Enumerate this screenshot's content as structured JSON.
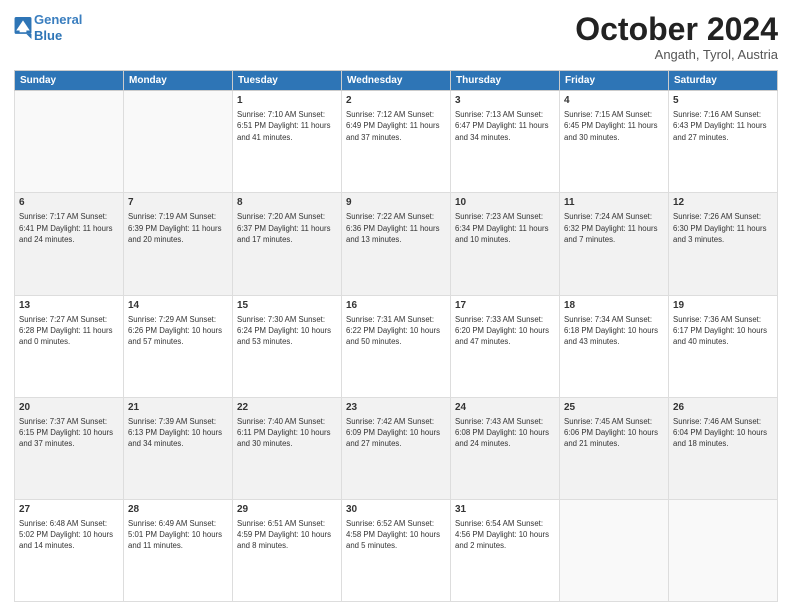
{
  "header": {
    "logo_line1": "General",
    "logo_line2": "Blue",
    "month": "October 2024",
    "location": "Angath, Tyrol, Austria"
  },
  "weekdays": [
    "Sunday",
    "Monday",
    "Tuesday",
    "Wednesday",
    "Thursday",
    "Friday",
    "Saturday"
  ],
  "weeks": [
    [
      {
        "day": "",
        "info": ""
      },
      {
        "day": "",
        "info": ""
      },
      {
        "day": "1",
        "info": "Sunrise: 7:10 AM\nSunset: 6:51 PM\nDaylight: 11 hours and 41 minutes."
      },
      {
        "day": "2",
        "info": "Sunrise: 7:12 AM\nSunset: 6:49 PM\nDaylight: 11 hours and 37 minutes."
      },
      {
        "day": "3",
        "info": "Sunrise: 7:13 AM\nSunset: 6:47 PM\nDaylight: 11 hours and 34 minutes."
      },
      {
        "day": "4",
        "info": "Sunrise: 7:15 AM\nSunset: 6:45 PM\nDaylight: 11 hours and 30 minutes."
      },
      {
        "day": "5",
        "info": "Sunrise: 7:16 AM\nSunset: 6:43 PM\nDaylight: 11 hours and 27 minutes."
      }
    ],
    [
      {
        "day": "6",
        "info": "Sunrise: 7:17 AM\nSunset: 6:41 PM\nDaylight: 11 hours and 24 minutes."
      },
      {
        "day": "7",
        "info": "Sunrise: 7:19 AM\nSunset: 6:39 PM\nDaylight: 11 hours and 20 minutes."
      },
      {
        "day": "8",
        "info": "Sunrise: 7:20 AM\nSunset: 6:37 PM\nDaylight: 11 hours and 17 minutes."
      },
      {
        "day": "9",
        "info": "Sunrise: 7:22 AM\nSunset: 6:36 PM\nDaylight: 11 hours and 13 minutes."
      },
      {
        "day": "10",
        "info": "Sunrise: 7:23 AM\nSunset: 6:34 PM\nDaylight: 11 hours and 10 minutes."
      },
      {
        "day": "11",
        "info": "Sunrise: 7:24 AM\nSunset: 6:32 PM\nDaylight: 11 hours and 7 minutes."
      },
      {
        "day": "12",
        "info": "Sunrise: 7:26 AM\nSunset: 6:30 PM\nDaylight: 11 hours and 3 minutes."
      }
    ],
    [
      {
        "day": "13",
        "info": "Sunrise: 7:27 AM\nSunset: 6:28 PM\nDaylight: 11 hours and 0 minutes."
      },
      {
        "day": "14",
        "info": "Sunrise: 7:29 AM\nSunset: 6:26 PM\nDaylight: 10 hours and 57 minutes."
      },
      {
        "day": "15",
        "info": "Sunrise: 7:30 AM\nSunset: 6:24 PM\nDaylight: 10 hours and 53 minutes."
      },
      {
        "day": "16",
        "info": "Sunrise: 7:31 AM\nSunset: 6:22 PM\nDaylight: 10 hours and 50 minutes."
      },
      {
        "day": "17",
        "info": "Sunrise: 7:33 AM\nSunset: 6:20 PM\nDaylight: 10 hours and 47 minutes."
      },
      {
        "day": "18",
        "info": "Sunrise: 7:34 AM\nSunset: 6:18 PM\nDaylight: 10 hours and 43 minutes."
      },
      {
        "day": "19",
        "info": "Sunrise: 7:36 AM\nSunset: 6:17 PM\nDaylight: 10 hours and 40 minutes."
      }
    ],
    [
      {
        "day": "20",
        "info": "Sunrise: 7:37 AM\nSunset: 6:15 PM\nDaylight: 10 hours and 37 minutes."
      },
      {
        "day": "21",
        "info": "Sunrise: 7:39 AM\nSunset: 6:13 PM\nDaylight: 10 hours and 34 minutes."
      },
      {
        "day": "22",
        "info": "Sunrise: 7:40 AM\nSunset: 6:11 PM\nDaylight: 10 hours and 30 minutes."
      },
      {
        "day": "23",
        "info": "Sunrise: 7:42 AM\nSunset: 6:09 PM\nDaylight: 10 hours and 27 minutes."
      },
      {
        "day": "24",
        "info": "Sunrise: 7:43 AM\nSunset: 6:08 PM\nDaylight: 10 hours and 24 minutes."
      },
      {
        "day": "25",
        "info": "Sunrise: 7:45 AM\nSunset: 6:06 PM\nDaylight: 10 hours and 21 minutes."
      },
      {
        "day": "26",
        "info": "Sunrise: 7:46 AM\nSunset: 6:04 PM\nDaylight: 10 hours and 18 minutes."
      }
    ],
    [
      {
        "day": "27",
        "info": "Sunrise: 6:48 AM\nSunset: 5:02 PM\nDaylight: 10 hours and 14 minutes."
      },
      {
        "day": "28",
        "info": "Sunrise: 6:49 AM\nSunset: 5:01 PM\nDaylight: 10 hours and 11 minutes."
      },
      {
        "day": "29",
        "info": "Sunrise: 6:51 AM\nSunset: 4:59 PM\nDaylight: 10 hours and 8 minutes."
      },
      {
        "day": "30",
        "info": "Sunrise: 6:52 AM\nSunset: 4:58 PM\nDaylight: 10 hours and 5 minutes."
      },
      {
        "day": "31",
        "info": "Sunrise: 6:54 AM\nSunset: 4:56 PM\nDaylight: 10 hours and 2 minutes."
      },
      {
        "day": "",
        "info": ""
      },
      {
        "day": "",
        "info": ""
      }
    ]
  ]
}
